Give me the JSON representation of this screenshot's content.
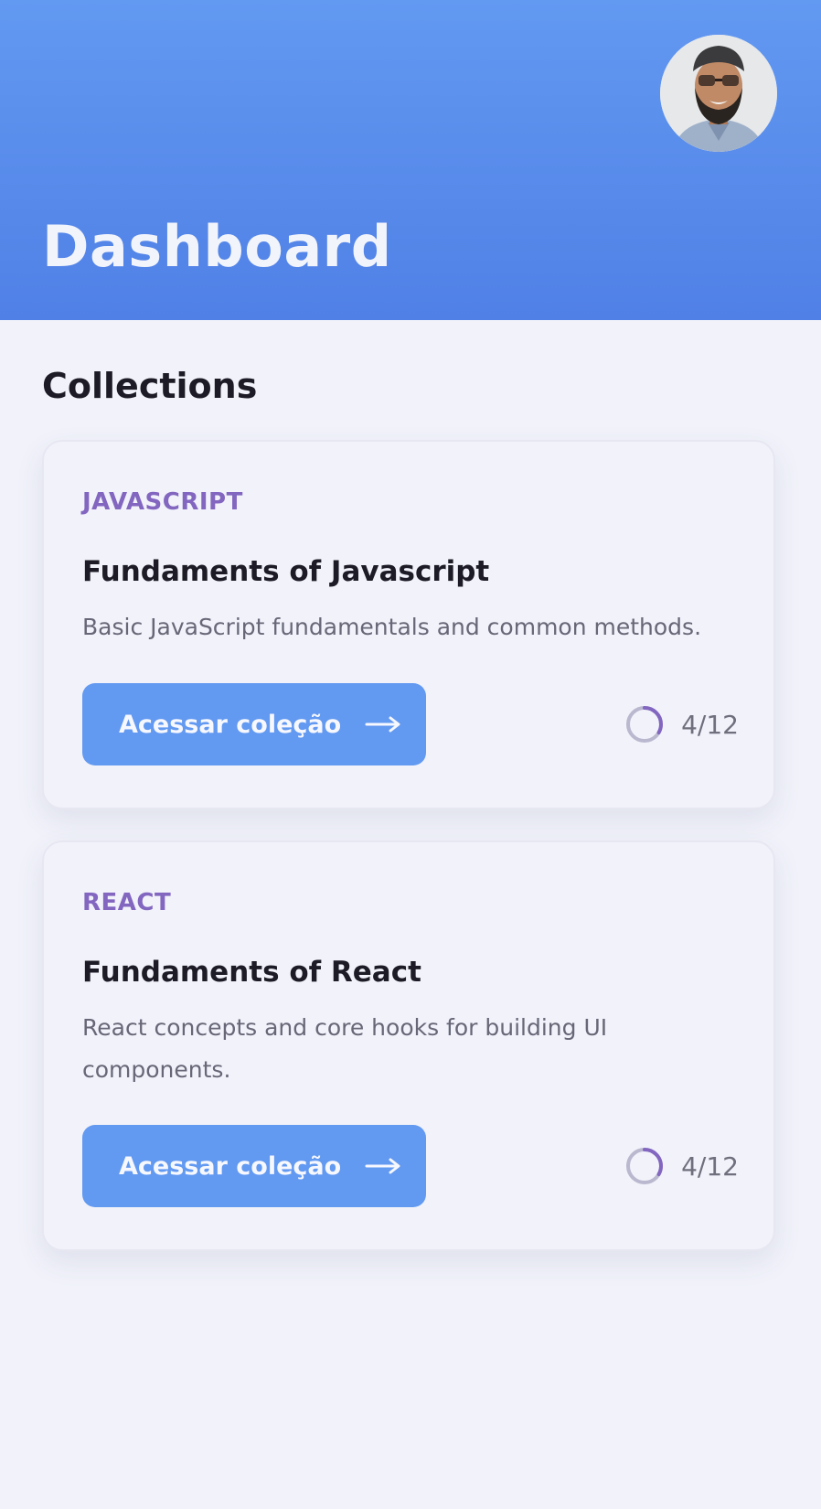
{
  "header": {
    "title": "Dashboard",
    "avatar_icon": "user-avatar-icon",
    "gradient_top": "#6299f1",
    "gradient_bottom": "#5080e6"
  },
  "section": {
    "title": "Collections"
  },
  "collections": [
    {
      "tag": "JAVASCRIPT",
      "title": "Fundaments of Javascript",
      "description": "Basic JavaScript fundamentals and common methods.",
      "button_label": "Acessar coleção",
      "button_icon": "arrow-right-icon",
      "progress_text": "4/12",
      "progress_fraction": 0.333
    },
    {
      "tag": "REACT",
      "title": "Fundaments of React",
      "description": "React concepts and core hooks for building UI components.",
      "button_label": "Acessar coleção",
      "button_icon": "arrow-right-icon",
      "progress_text": "4/12",
      "progress_fraction": 0.333
    }
  ],
  "colors": {
    "accent": "#6299f1",
    "tag": "#8266c0",
    "background": "#f1f2fa"
  }
}
